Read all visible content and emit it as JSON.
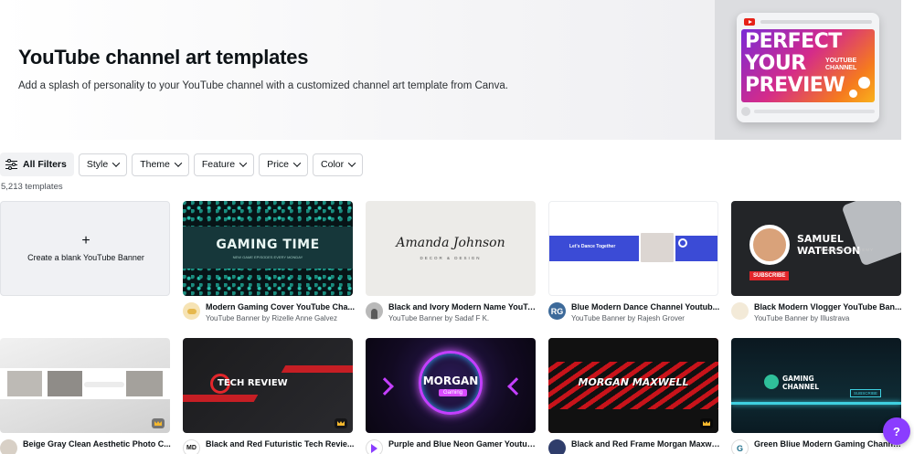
{
  "hero": {
    "title": "YouTube channel art templates",
    "subtitle": "Add a splash of personality to your YouTube channel with a customized channel art template from Canva.",
    "promo": {
      "line1": "PERFECT",
      "line2": "YOUR",
      "line3": "PREVIEW",
      "small1": "YOUTUBE",
      "small2": "CHANNEL"
    }
  },
  "filters": {
    "all_label": "All Filters",
    "items": [
      {
        "label": "Style"
      },
      {
        "label": "Theme"
      },
      {
        "label": "Feature"
      },
      {
        "label": "Price"
      },
      {
        "label": "Color"
      }
    ]
  },
  "count_label": "5,213 templates",
  "blank_card": {
    "plus": "+",
    "label": "Create a blank YouTube Banner"
  },
  "templates": [
    {
      "title": "Modern Gaming Cover YouTube Cha...",
      "subtitle": "YouTube Banner by Rizelle Anne Galvez",
      "thumb_text": "GAMING TIME",
      "thumb_sub": "NEW GAME EPISODES EVERY MONDAY",
      "avatar": ""
    },
    {
      "title": "Black and Ivory Modern Name YouTu...",
      "subtitle": "YouTube Banner by Sadaf F K.",
      "thumb_text": "Amanda Johnson",
      "thumb_sub": "DECOR & DESIGN",
      "avatar": ""
    },
    {
      "title": "Blue Modern Dance Channel Youtub...",
      "subtitle": "YouTube Banner by Rajesh Grover",
      "thumb_text": "Let's Dance Together",
      "avatar": "RG"
    },
    {
      "title": "Black Modern Vlogger YouTube Ban...",
      "subtitle": "YouTube Banner by Illustrava",
      "thumb_text": "SAMUEL WATERSON",
      "thumb_sub": "FINANCE ACADEMY",
      "thumb_btn": "SUBSCRIBE",
      "avatar": ""
    },
    {
      "title": "Beige Gray Clean Aesthetic Photo C...",
      "subtitle": "",
      "avatar": ""
    },
    {
      "title": "Black and Red Futuristic Tech Revie...",
      "subtitle": "",
      "thumb_text": "TECH REVIEW",
      "avatar": "MD"
    },
    {
      "title": "Purple and Blue Neon Gamer Youtub...",
      "subtitle": "",
      "thumb_text": "MORGAN",
      "thumb_sub": "Gaming",
      "avatar": ""
    },
    {
      "title": "Black and Red Frame Morgan Maxwe...",
      "subtitle": "",
      "thumb_text": "MORGAN MAXWELL",
      "avatar": ""
    },
    {
      "title": "Green Bliue Modern Gaming Channe...",
      "subtitle": "",
      "thumb_text": "GAMING CHANNEL",
      "thumb_btn": "SUBSCRIBE",
      "avatar": "G"
    }
  ],
  "help_label": "?",
  "colors": {
    "accent": "#8b3dff",
    "hero_bg": "#f4f4f6",
    "subscribe_red": "#e3262b",
    "dance_blue": "#3b4bd6"
  }
}
